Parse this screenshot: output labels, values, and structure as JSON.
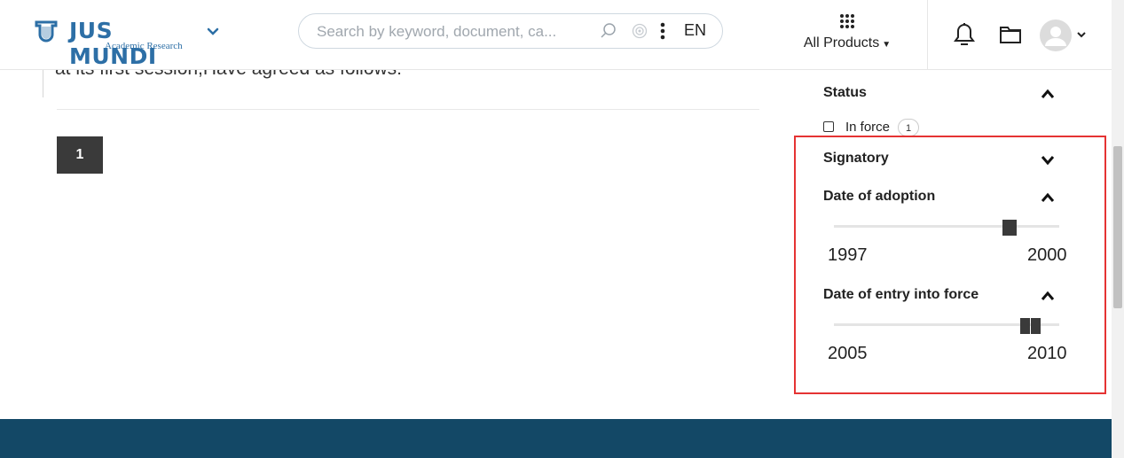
{
  "header": {
    "brand": {
      "name": "JUS MUNDI",
      "subtitle": "Academic Research"
    },
    "search": {
      "placeholder": "Search by keyword, document, ca...",
      "language": "EN"
    },
    "products_label": "All Products",
    "icons": [
      "brand-logo-icon",
      "chevron-down-icon",
      "search-icon",
      "target-icon",
      "kebab-menu-icon",
      "apps-grid-icon",
      "bell-icon",
      "folder-icon",
      "avatar-icon"
    ]
  },
  "main": {
    "excerpt_text": "at its first session,Have agreed as follows:",
    "pagination": {
      "current_page": "1"
    }
  },
  "filters": {
    "status": {
      "title": "Status",
      "expanded": true,
      "options": [
        {
          "label": "In force",
          "count": "1",
          "checked": false
        }
      ]
    },
    "signatory": {
      "title": "Signatory",
      "expanded": false
    },
    "date_of_adoption": {
      "title": "Date of adoption",
      "expanded": true,
      "min": "1997",
      "max": "2000"
    },
    "date_of_entry_into_force": {
      "title": "Date of entry into force",
      "expanded": true,
      "min": "2005",
      "max": "2010"
    }
  },
  "colors": {
    "brand_blue": "#2d6fa6",
    "footer": "#134866",
    "highlight": "#e53333",
    "handle": "#3a3a3a"
  }
}
